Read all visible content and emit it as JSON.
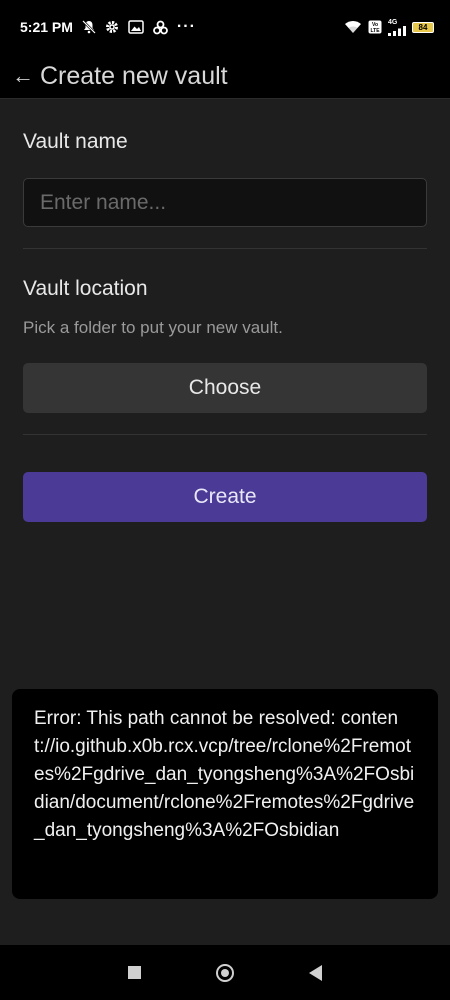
{
  "status_bar": {
    "time": "5:21 PM",
    "more": "···",
    "network": "4G",
    "battery": "84",
    "icons": [
      "mute-icon",
      "gear-icon",
      "photo-icon",
      "app-icon",
      "wifi-icon",
      "volte-icon",
      "signal-icon",
      "battery-icon"
    ]
  },
  "header": {
    "back_icon": "←",
    "title": "Create new vault"
  },
  "form": {
    "vault_name_label": "Vault name",
    "vault_name_placeholder": "Enter name...",
    "vault_location_label": "Vault location",
    "vault_location_description": "Pick a folder to put your new vault.",
    "choose_label": "Choose",
    "create_label": "Create"
  },
  "toast": {
    "message": "Error: This path cannot be resolved: content://io.github.x0b.rcx.vcp/tree/rclone%2Fremotes%2Fgdrive_dan_tyongsheng%3A%2FOsbidian/document/rclone%2Fremotes%2Fgdrive_dan_tyongsheng%3A%2FOsbidian"
  },
  "colors": {
    "accent": "#4b3a96",
    "background": "#1e1e1e"
  }
}
